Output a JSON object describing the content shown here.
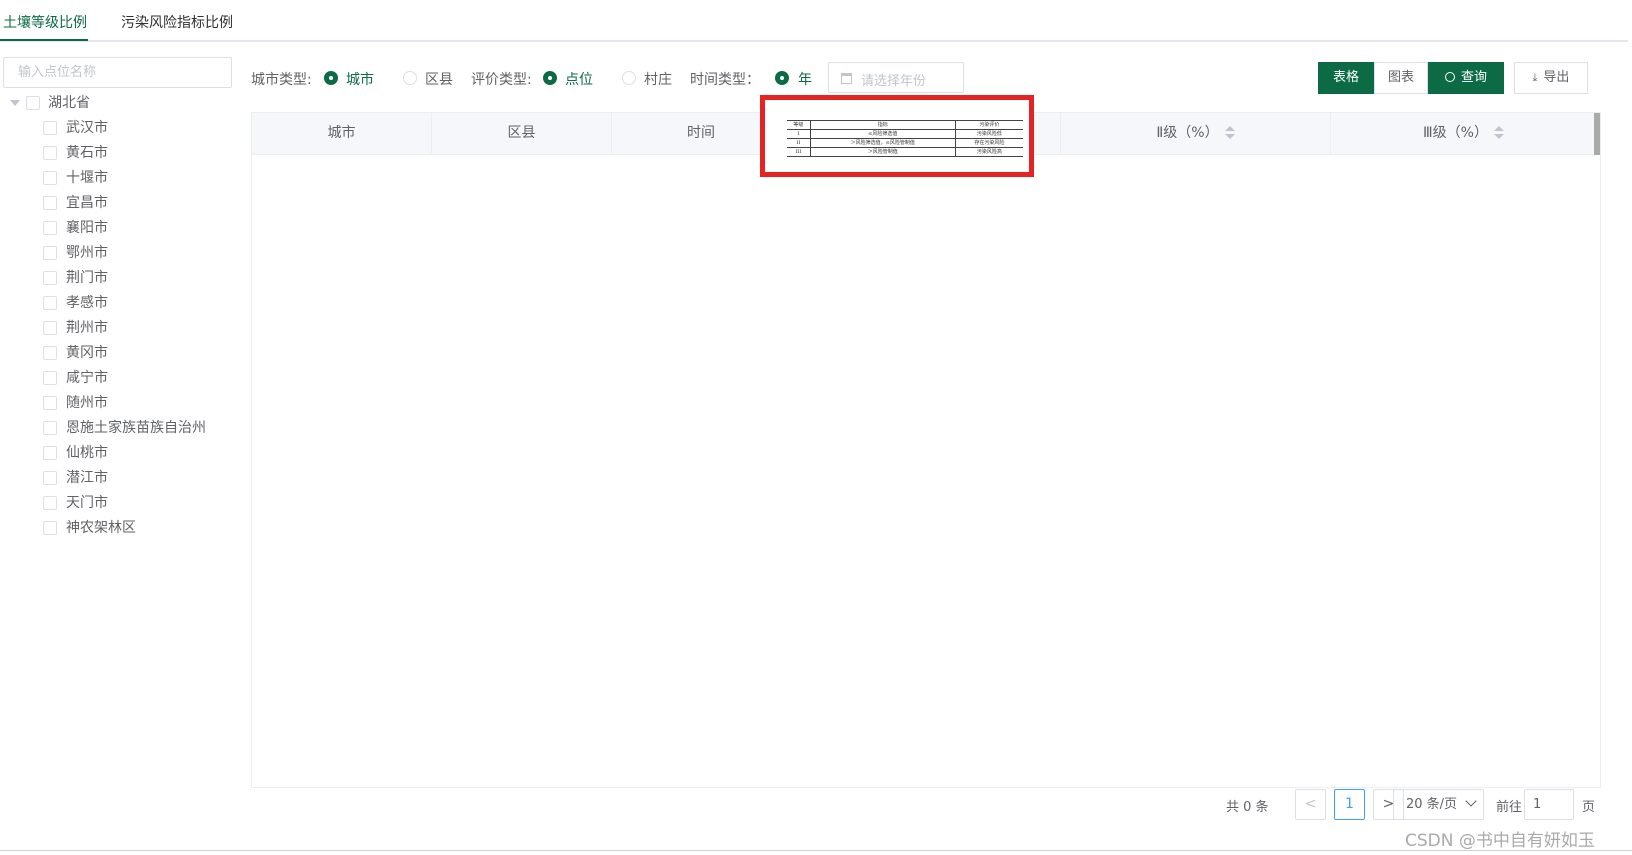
{
  "tabs": [
    {
      "label": "土壤等级比例",
      "active": true
    },
    {
      "label": "污染风险指标比例",
      "active": false
    }
  ],
  "sidebar": {
    "search_placeholder": "输入点位名称",
    "root": "湖北省",
    "items": [
      "武汉市",
      "黄石市",
      "十堰市",
      "宜昌市",
      "襄阳市",
      "鄂州市",
      "荆门市",
      "孝感市",
      "荆州市",
      "黄冈市",
      "咸宁市",
      "随州市",
      "恩施土家族苗族自治州",
      "仙桃市",
      "潜江市",
      "天门市",
      "神农架林区"
    ]
  },
  "filters": {
    "city_type_label": "城市类型:",
    "city_option": "城市",
    "county_option": "区县",
    "eval_type_label": "评价类型:",
    "point_option": "点位",
    "village_option": "村庄",
    "time_type_label": "时间类型：",
    "year_option": "年",
    "year_placeholder": "请选择年份"
  },
  "buttons": {
    "table": "表格",
    "chart": "图表",
    "query": "查询",
    "export": "导出"
  },
  "table": {
    "columns": [
      "城市",
      "区县",
      "时间",
      "",
      "Ⅱ级（%）",
      "Ⅲ级（%）"
    ]
  },
  "inset_table": {
    "rows": [
      [
        "等级",
        "指标",
        "污染评价"
      ],
      [
        "I",
        "≤风险筛选值",
        "污染风险低"
      ],
      [
        "II",
        "＞风险筛选值，≤风险管制值",
        "存在污染风险"
      ],
      [
        "III",
        "＞风险管制值",
        "污染风险高"
      ]
    ]
  },
  "pagination": {
    "total": "共 0 条",
    "prev": "<",
    "current": "1",
    "next": ">",
    "page_size": "20 条/页",
    "goto_label": "前往",
    "goto_value": "1",
    "page_suffix": "页"
  },
  "watermark": "CSDN @书中自有妍如玉",
  "colors": {
    "accent": "#0c6b45",
    "highlight": "#e52323"
  }
}
